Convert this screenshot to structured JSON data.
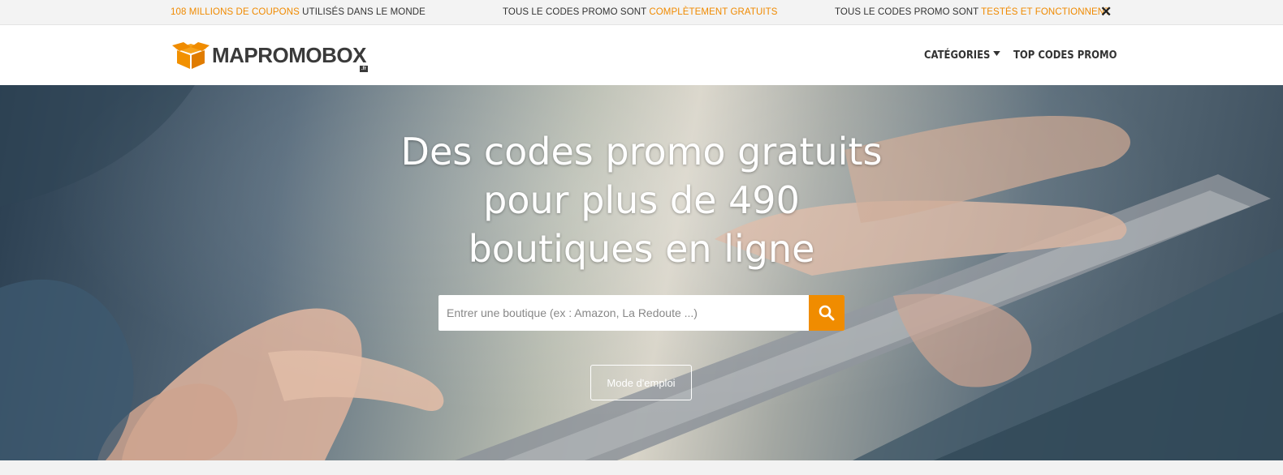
{
  "topbar": {
    "msg1_highlight": "108 MILLIONS DE COUPONS",
    "msg1_rest": " UTILISÉS DANS LE MONDE",
    "msg2_rest": "TOUS LE CODES PROMO SONT ",
    "msg2_highlight": "COMPLÈTEMENT GRATUITS",
    "msg3_rest": "TOUS LE CODES PROMO SONT ",
    "msg3_highlight": "TESTÉS ET FONCTIONNENT",
    "close_icon": "close-icon",
    "highlight_color": "#f08a00"
  },
  "header": {
    "logo_text": "MAPROMOBOX",
    "logo_tld": ".fr",
    "logo_icon": "box-logo-icon",
    "nav": {
      "categories": "CATÉGORIES",
      "top_codes": "TOP CODES PROMO"
    }
  },
  "hero": {
    "title_line1": "Des codes promo gratuits",
    "title_line2": "pour plus de 490",
    "title_line3": "boutiques en ligne",
    "search_placeholder": "Entrer une boutique (ex : Amazon, La Redoute ...)",
    "search_icon": "search-icon",
    "search_button_color": "#f08c00",
    "mode_button": "Mode d'emploi"
  }
}
